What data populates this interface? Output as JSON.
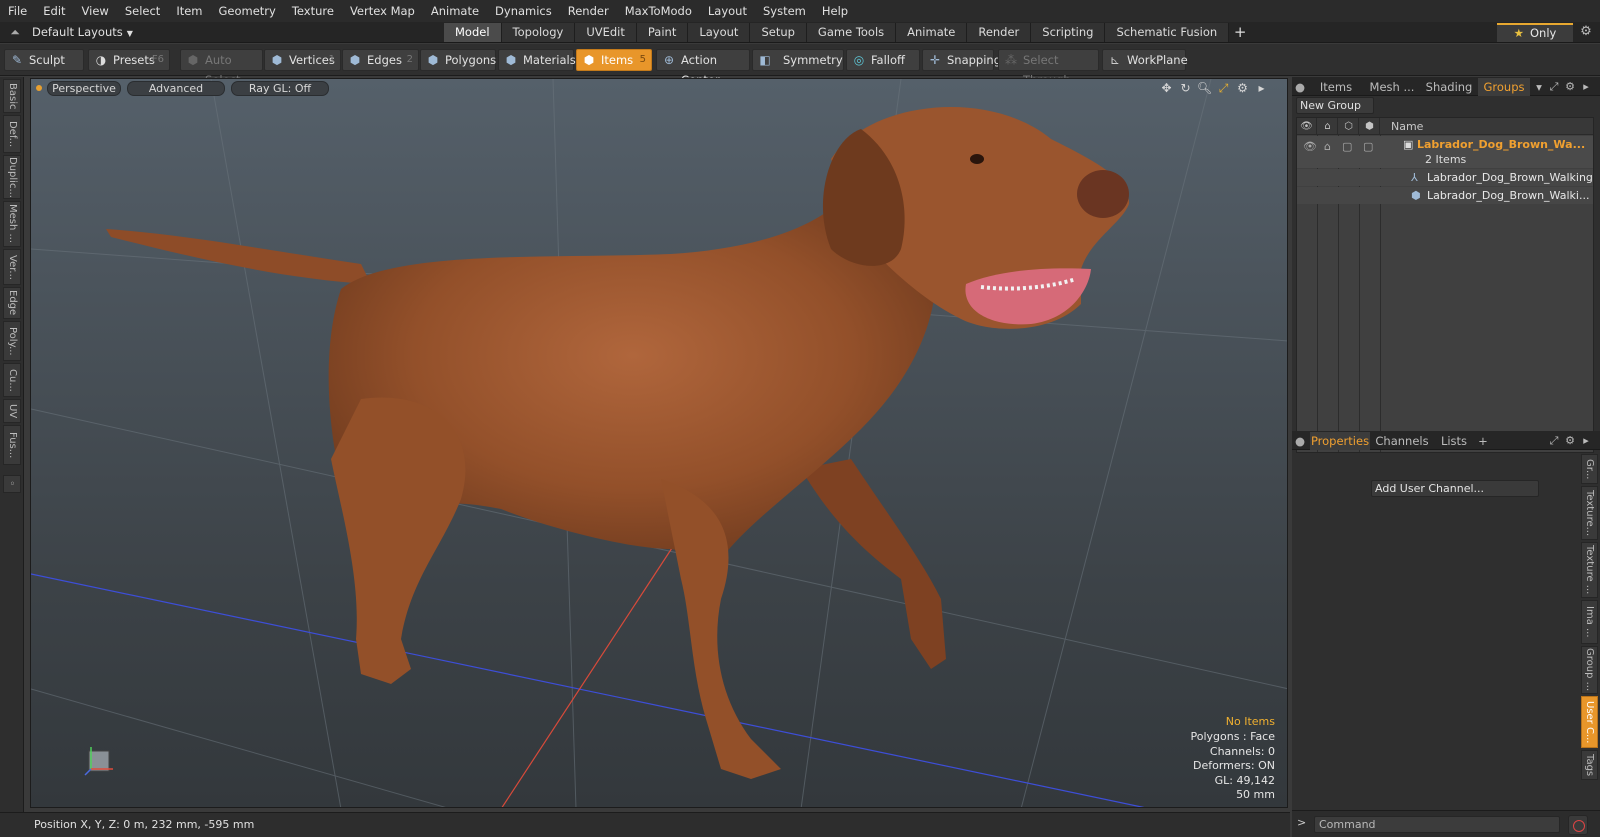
{
  "menu": [
    "File",
    "Edit",
    "View",
    "Select",
    "Item",
    "Geometry",
    "Texture",
    "Vertex Map",
    "Animate",
    "Dynamics",
    "Render",
    "MaxToModo",
    "Layout",
    "System",
    "Help"
  ],
  "layout": {
    "selector": "Default Layouts",
    "only_label": "Only"
  },
  "tabs": [
    {
      "label": "Model",
      "active": true
    },
    {
      "label": "Topology"
    },
    {
      "label": "UVEdit"
    },
    {
      "label": "Paint"
    },
    {
      "label": "Layout"
    },
    {
      "label": "Setup"
    },
    {
      "label": "Game Tools"
    },
    {
      "label": "Animate"
    },
    {
      "label": "Render"
    },
    {
      "label": "Scripting"
    },
    {
      "label": "Schematic Fusion"
    }
  ],
  "toolbar": {
    "sculpt": "Sculpt",
    "presets": "Presets",
    "presets_key": "F6",
    "auto_select": "Auto Select",
    "vertices": "Vertices",
    "vertices_key": "1",
    "edges": "Edges",
    "edges_key": "2",
    "polygons": "Polygons",
    "materials": "Materials",
    "items": "Items",
    "items_key": "5",
    "action_center": "Action Center",
    "symmetry": "Symmetry",
    "falloff": "Falloff",
    "snapping": "Snapping",
    "select_through": "Select Through",
    "workplane": "WorkPlane"
  },
  "left_tabs": [
    "Basic",
    "Def...",
    "Duplic...",
    "Mesh ...",
    "Ver...",
    "Edge",
    "Poly...",
    "Cu...",
    "UV",
    "Fus..."
  ],
  "viewport": {
    "perspective": "Perspective",
    "advanced": "Advanced",
    "raygl": "Ray GL: Off",
    "info": {
      "no_items": "No Items",
      "polygons": "Polygons : Face",
      "channels": "Channels: 0",
      "deformers": "Deformers: ON",
      "gl": "GL: 49,142",
      "scale": "50 mm"
    }
  },
  "status": {
    "position": "Position X, Y, Z:   0 m, 232 mm, -595 mm"
  },
  "panel_top": {
    "tabs": [
      "Items",
      "Mesh ...",
      "Shading",
      "Groups"
    ],
    "new_group": "New Group",
    "col_name": "Name",
    "group_name": "Labrador_Dog_Brown_Wa...",
    "group_count": "2 Items",
    "child1": "Labrador_Dog_Brown_Walking",
    "child2": "Labrador_Dog_Brown_Walki..."
  },
  "panel_bottom": {
    "tabs": [
      "Properties",
      "Channels",
      "Lists"
    ],
    "add_user_channel": "Add User Channel...",
    "side_tabs": [
      "Gr...",
      "Texture...",
      "Texture ...",
      "Ima ...",
      "Group ...",
      "User C...",
      "Tags"
    ]
  },
  "command": {
    "placeholder": "Command"
  },
  "colors": {
    "accent": "#e8962a",
    "highlight": "#f0a030"
  }
}
